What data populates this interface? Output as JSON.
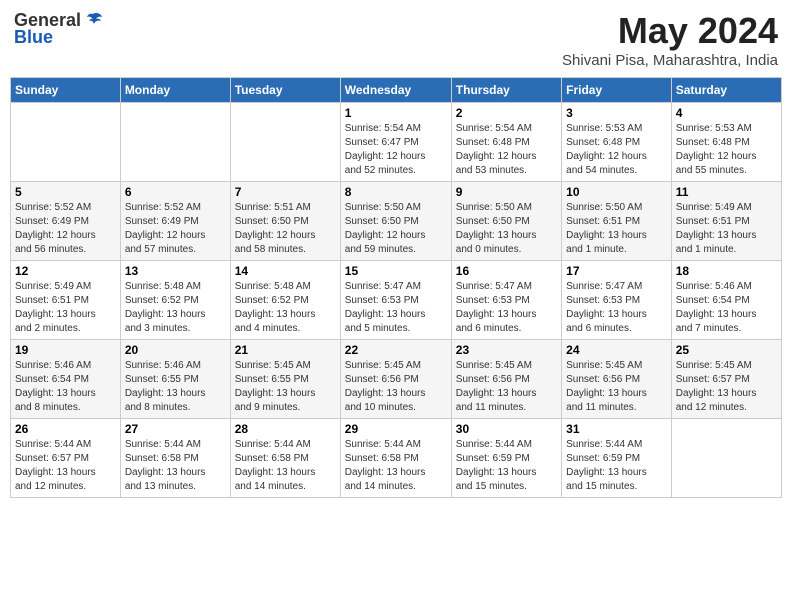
{
  "header": {
    "logo_general": "General",
    "logo_blue": "Blue",
    "month": "May 2024",
    "location": "Shivani Pisa, Maharashtra, India"
  },
  "weekdays": [
    "Sunday",
    "Monday",
    "Tuesday",
    "Wednesday",
    "Thursday",
    "Friday",
    "Saturday"
  ],
  "weeks": [
    [
      {
        "day": "",
        "info": ""
      },
      {
        "day": "",
        "info": ""
      },
      {
        "day": "",
        "info": ""
      },
      {
        "day": "1",
        "info": "Sunrise: 5:54 AM\nSunset: 6:47 PM\nDaylight: 12 hours\nand 52 minutes."
      },
      {
        "day": "2",
        "info": "Sunrise: 5:54 AM\nSunset: 6:48 PM\nDaylight: 12 hours\nand 53 minutes."
      },
      {
        "day": "3",
        "info": "Sunrise: 5:53 AM\nSunset: 6:48 PM\nDaylight: 12 hours\nand 54 minutes."
      },
      {
        "day": "4",
        "info": "Sunrise: 5:53 AM\nSunset: 6:48 PM\nDaylight: 12 hours\nand 55 minutes."
      }
    ],
    [
      {
        "day": "5",
        "info": "Sunrise: 5:52 AM\nSunset: 6:49 PM\nDaylight: 12 hours\nand 56 minutes."
      },
      {
        "day": "6",
        "info": "Sunrise: 5:52 AM\nSunset: 6:49 PM\nDaylight: 12 hours\nand 57 minutes."
      },
      {
        "day": "7",
        "info": "Sunrise: 5:51 AM\nSunset: 6:50 PM\nDaylight: 12 hours\nand 58 minutes."
      },
      {
        "day": "8",
        "info": "Sunrise: 5:50 AM\nSunset: 6:50 PM\nDaylight: 12 hours\nand 59 minutes."
      },
      {
        "day": "9",
        "info": "Sunrise: 5:50 AM\nSunset: 6:50 PM\nDaylight: 13 hours\nand 0 minutes."
      },
      {
        "day": "10",
        "info": "Sunrise: 5:50 AM\nSunset: 6:51 PM\nDaylight: 13 hours\nand 1 minute."
      },
      {
        "day": "11",
        "info": "Sunrise: 5:49 AM\nSunset: 6:51 PM\nDaylight: 13 hours\nand 1 minute."
      }
    ],
    [
      {
        "day": "12",
        "info": "Sunrise: 5:49 AM\nSunset: 6:51 PM\nDaylight: 13 hours\nand 2 minutes."
      },
      {
        "day": "13",
        "info": "Sunrise: 5:48 AM\nSunset: 6:52 PM\nDaylight: 13 hours\nand 3 minutes."
      },
      {
        "day": "14",
        "info": "Sunrise: 5:48 AM\nSunset: 6:52 PM\nDaylight: 13 hours\nand 4 minutes."
      },
      {
        "day": "15",
        "info": "Sunrise: 5:47 AM\nSunset: 6:53 PM\nDaylight: 13 hours\nand 5 minutes."
      },
      {
        "day": "16",
        "info": "Sunrise: 5:47 AM\nSunset: 6:53 PM\nDaylight: 13 hours\nand 6 minutes."
      },
      {
        "day": "17",
        "info": "Sunrise: 5:47 AM\nSunset: 6:53 PM\nDaylight: 13 hours\nand 6 minutes."
      },
      {
        "day": "18",
        "info": "Sunrise: 5:46 AM\nSunset: 6:54 PM\nDaylight: 13 hours\nand 7 minutes."
      }
    ],
    [
      {
        "day": "19",
        "info": "Sunrise: 5:46 AM\nSunset: 6:54 PM\nDaylight: 13 hours\nand 8 minutes."
      },
      {
        "day": "20",
        "info": "Sunrise: 5:46 AM\nSunset: 6:55 PM\nDaylight: 13 hours\nand 8 minutes."
      },
      {
        "day": "21",
        "info": "Sunrise: 5:45 AM\nSunset: 6:55 PM\nDaylight: 13 hours\nand 9 minutes."
      },
      {
        "day": "22",
        "info": "Sunrise: 5:45 AM\nSunset: 6:56 PM\nDaylight: 13 hours\nand 10 minutes."
      },
      {
        "day": "23",
        "info": "Sunrise: 5:45 AM\nSunset: 6:56 PM\nDaylight: 13 hours\nand 11 minutes."
      },
      {
        "day": "24",
        "info": "Sunrise: 5:45 AM\nSunset: 6:56 PM\nDaylight: 13 hours\nand 11 minutes."
      },
      {
        "day": "25",
        "info": "Sunrise: 5:45 AM\nSunset: 6:57 PM\nDaylight: 13 hours\nand 12 minutes."
      }
    ],
    [
      {
        "day": "26",
        "info": "Sunrise: 5:44 AM\nSunset: 6:57 PM\nDaylight: 13 hours\nand 12 minutes."
      },
      {
        "day": "27",
        "info": "Sunrise: 5:44 AM\nSunset: 6:58 PM\nDaylight: 13 hours\nand 13 minutes."
      },
      {
        "day": "28",
        "info": "Sunrise: 5:44 AM\nSunset: 6:58 PM\nDaylight: 13 hours\nand 14 minutes."
      },
      {
        "day": "29",
        "info": "Sunrise: 5:44 AM\nSunset: 6:58 PM\nDaylight: 13 hours\nand 14 minutes."
      },
      {
        "day": "30",
        "info": "Sunrise: 5:44 AM\nSunset: 6:59 PM\nDaylight: 13 hours\nand 15 minutes."
      },
      {
        "day": "31",
        "info": "Sunrise: 5:44 AM\nSunset: 6:59 PM\nDaylight: 13 hours\nand 15 minutes."
      },
      {
        "day": "",
        "info": ""
      }
    ]
  ]
}
